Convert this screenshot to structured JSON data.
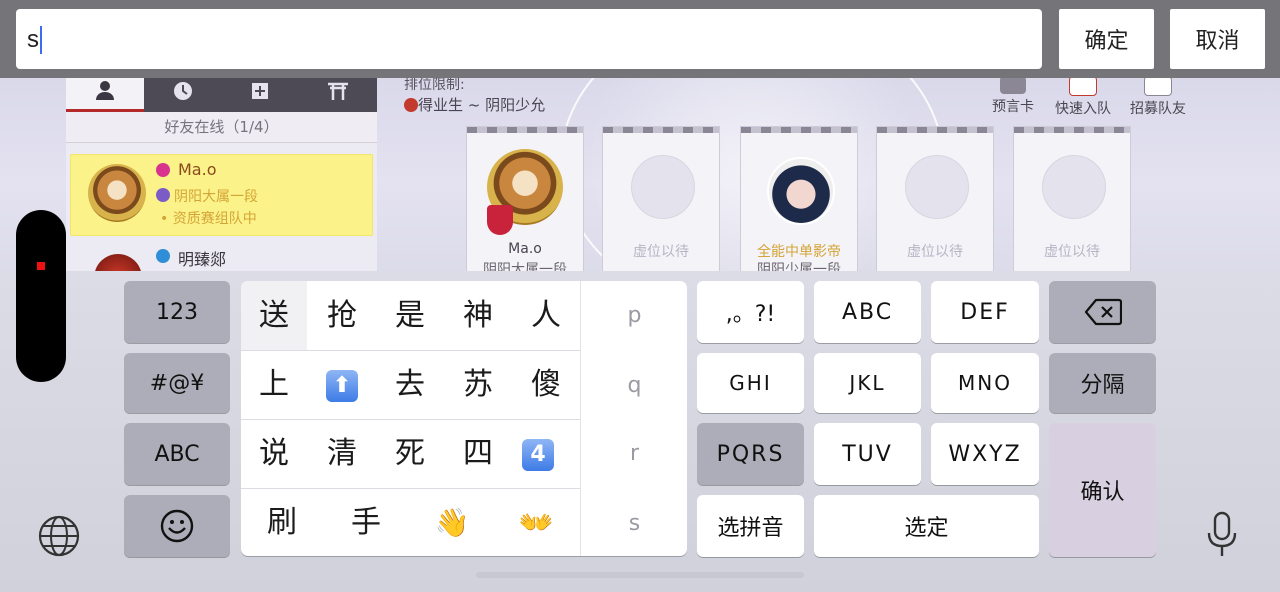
{
  "input_bar": {
    "text": "s",
    "confirm_label": "确定",
    "cancel_label": "取消"
  },
  "game": {
    "friend_panel": {
      "online_label": "好友在线（1/4）",
      "friends": [
        {
          "name": "Ma.o",
          "rank": "阴阳大属一段",
          "status": "• 资质赛组队中"
        },
        {
          "name": "明臻郯"
        }
      ]
    },
    "rank_limit_label": "排位限制:",
    "rank_range": "得业生 ~ 阴阳少允",
    "top_buttons": [
      "预言卡",
      "快速入队",
      "招募队友"
    ],
    "slots": [
      {
        "label": "Ma.o",
        "sub": "阴阳大属一段"
      },
      {
        "label": "虚位以待"
      },
      {
        "label": "全能中单影帝",
        "sub": "阴阳少属一段"
      },
      {
        "label": "虚位以待"
      },
      {
        "label": "虚位以待"
      }
    ]
  },
  "keyboard": {
    "left_column": [
      "123",
      "#@¥",
      "ABC"
    ],
    "candidates": [
      [
        "送",
        "抢",
        "是",
        "神",
        "人"
      ],
      [
        "上",
        "⬆",
        "去",
        "苏",
        "傻"
      ],
      [
        "说",
        "清",
        "死",
        "四",
        "4"
      ],
      [
        "刷",
        "手",
        "👋",
        "👐"
      ]
    ],
    "pinyin_options": [
      "p",
      "q",
      "r",
      "s"
    ],
    "keys": {
      "punct": ",。?!",
      "abc": "ABC",
      "def": "DEF",
      "ghi": "GHI",
      "jkl": "JKL",
      "mno": "MNO",
      "pqrs": "PQRS",
      "tuv": "TUV",
      "wxyz": "WXYZ",
      "select_pinyin": "选拼音",
      "select_confirm": "选定",
      "separator": "分隔",
      "confirm": "确认"
    },
    "icons": [
      "delete-icon",
      "emoji-icon",
      "globe-icon",
      "microphone-icon"
    ]
  }
}
